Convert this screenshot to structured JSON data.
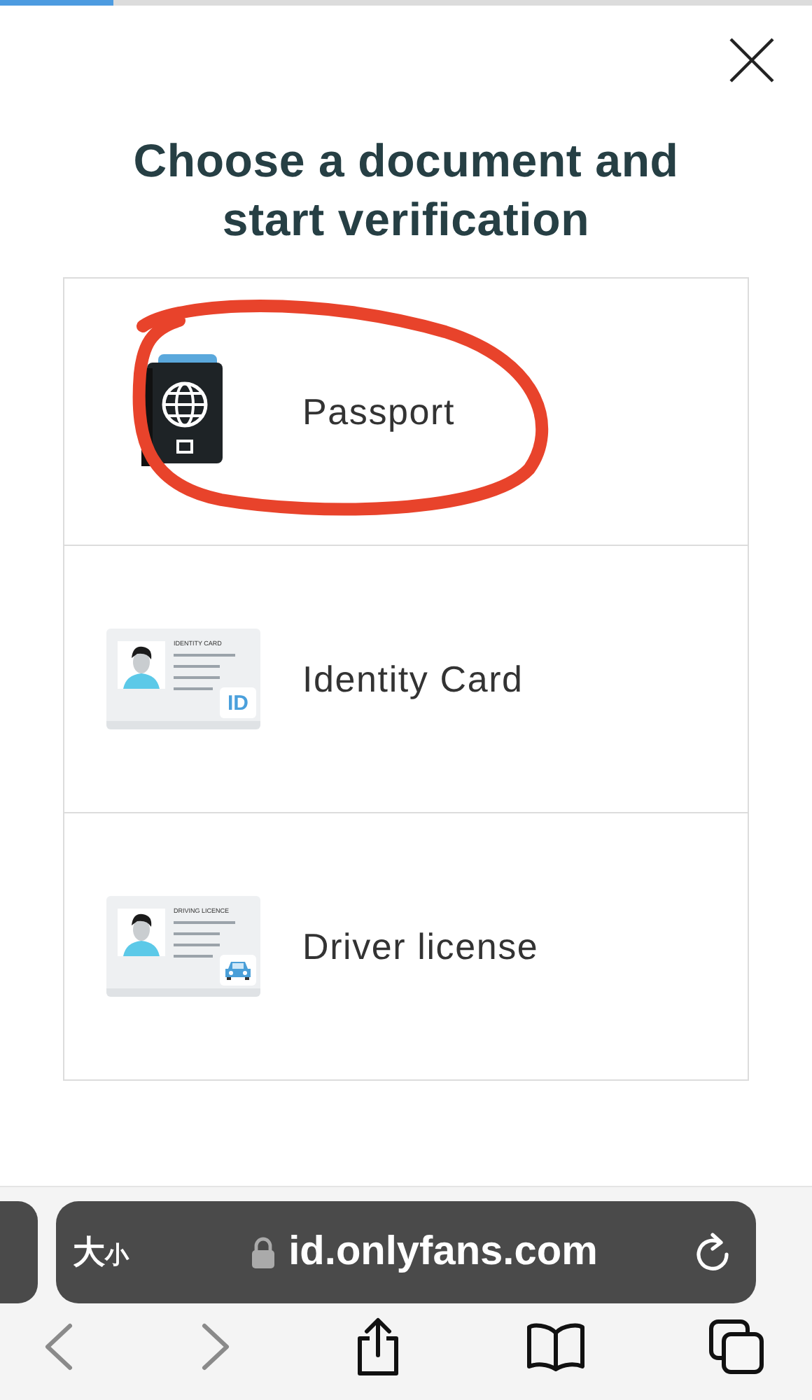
{
  "progress": {
    "level": 0.14
  },
  "title": "Choose a document and start verification",
  "documents": [
    {
      "kind": "passport",
      "label": "Passport",
      "circled": true
    },
    {
      "kind": "id_card",
      "label": "Identity Card",
      "card_title": "IDENTITY CARD",
      "badge": "ID",
      "circled": false
    },
    {
      "kind": "driver_license",
      "label": "Driver license",
      "card_title": "DRIVING LICENCE",
      "circled": false
    }
  ],
  "browser": {
    "text_size_button": "大小",
    "url": "id.onlyfans.com",
    "back_disabled": true,
    "forward_disabled": true
  }
}
